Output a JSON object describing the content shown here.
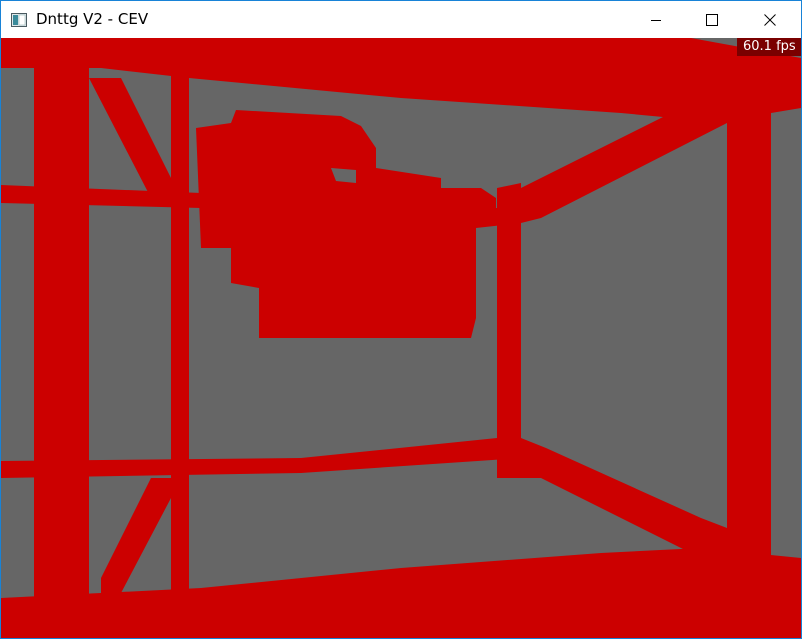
{
  "window": {
    "title": "Dnttg V2 - CEV",
    "border_color": "#1883d7"
  },
  "titlebar": {
    "icon": "app-window-icon",
    "minimize_icon": "minimize-icon",
    "maximize_icon": "maximize-icon",
    "close_icon": "close-icon"
  },
  "viewport": {
    "background_color": "#666666",
    "geometry_color": "#cc0000",
    "fps_label": "60.1 fps",
    "fps_background": "#7a0000"
  }
}
